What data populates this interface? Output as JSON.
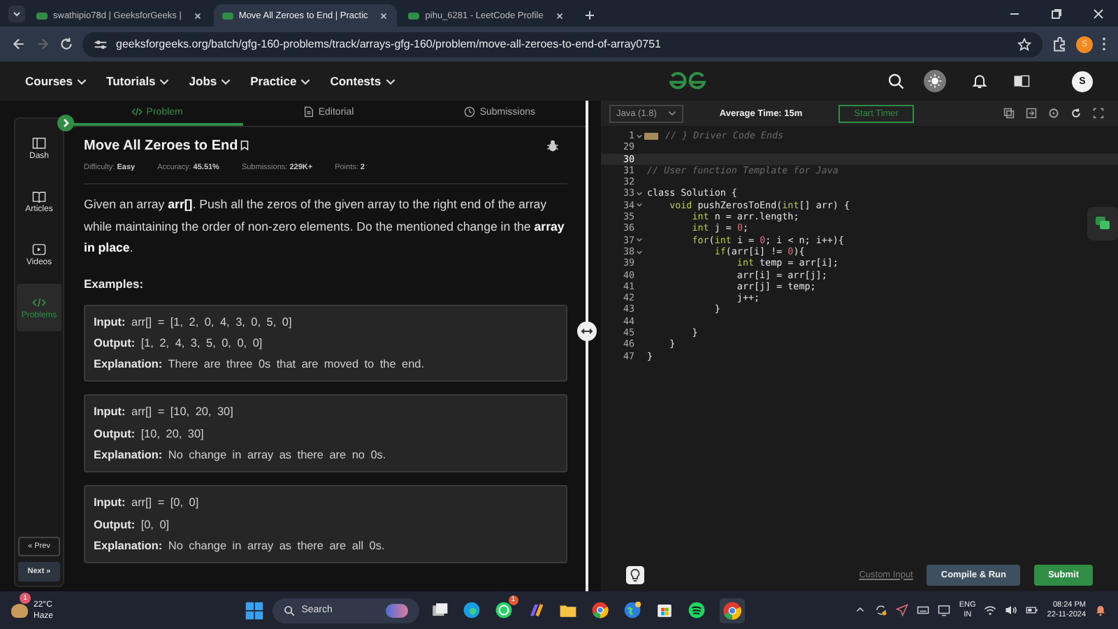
{
  "browser": {
    "tabs": [
      {
        "title": "swathipio78d | GeeksforGeeks |",
        "selected": false
      },
      {
        "title": "Move All Zeroes to End | Practic",
        "selected": true
      },
      {
        "title": "pihu_6281 - LeetCode Profile",
        "selected": false
      }
    ],
    "url": "geeksforgeeks.org/batch/gfg-160-problems/track/arrays-gfg-160/problem/move-all-zeroes-to-end-of-array0751",
    "profile_initial": "S"
  },
  "nav": {
    "items": [
      "Courses",
      "Tutorials",
      "Jobs",
      "Practice",
      "Contests"
    ],
    "avatar": "S"
  },
  "sidebar": {
    "items": [
      {
        "label": "Dash",
        "selected": false
      },
      {
        "label": "Articles",
        "selected": false
      },
      {
        "label": "Videos",
        "selected": false
      },
      {
        "label": "Problems",
        "selected": true
      }
    ],
    "prev": "« Prev",
    "next": "Next »"
  },
  "panel_tabs": [
    {
      "label": "Problem",
      "selected": true
    },
    {
      "label": "Editorial",
      "selected": false
    },
    {
      "label": "Submissions",
      "selected": false
    }
  ],
  "problem": {
    "title": "Move All Zeroes to End",
    "meta": [
      "Difficulty: **Easy**",
      "Accuracy: **45.51%**",
      "Submissions: **229K+**",
      "Points: **2**"
    ],
    "description": "Given an array **arr[]**. Push all the zeros of the given array to the right end of the array while maintaining the order of non-zero elements. Do the mentioned change in the **array in place**.",
    "examples_heading": "Examples:",
    "examples": [
      [
        "**Input:** arr[] = [1, 2, 0, 4, 3, 0, 5, 0]",
        "**Output:** [1, 2, 4, 3, 5, 0, 0, 0]",
        "**Explanation:** There are three 0s that are moved to the end."
      ],
      [
        "**Input:** arr[] = [10, 20, 30]",
        "**Output:** [10, 20, 30]",
        "**Explanation:** No change in array as there are no 0s."
      ],
      [
        "**Input:** arr[] = [0, 0]",
        "**Output:** [0, 0]",
        "**Explanation:** No change in array as there are all 0s."
      ]
    ]
  },
  "editor": {
    "language": "Java (1.8)",
    "average_time": "Average Time: 15m",
    "timer_button": "Start Timer",
    "lines": [
      {
        "n": "1",
        "fold": true,
        "folded": true,
        "active": false,
        "parts": [
          {
            "kind": "comment",
            "text": "// } Driver Code Ends"
          }
        ]
      },
      {
        "n": "29",
        "fold": false,
        "folded": false,
        "active": false
      },
      {
        "n": "30",
        "fold": false,
        "folded": false,
        "active": true
      },
      {
        "n": "31",
        "fold": false,
        "folded": false,
        "active": false,
        "parts": [
          {
            "kind": "comment",
            "text": "// User function Template for Java"
          }
        ]
      },
      {
        "n": "32",
        "fold": false,
        "folded": false,
        "active": false
      },
      {
        "n": "33",
        "fold": true,
        "folded": false,
        "active": false,
        "parts": [
          {
            "kind": "plain",
            "text": "class Solution {"
          }
        ]
      },
      {
        "n": "34",
        "fold": true,
        "folded": false,
        "active": false,
        "parts": [
          {
            "kind": "keyword",
            "text": "    void"
          },
          {
            "kind": "plain",
            "text": " pushZerosToEnd("
          },
          {
            "kind": "keyword",
            "text": "int"
          },
          {
            "kind": "plain",
            "text": "[] arr) {"
          }
        ]
      },
      {
        "n": "35",
        "fold": false,
        "folded": false,
        "active": false,
        "parts": [
          {
            "kind": "keyword",
            "text": "        int"
          },
          {
            "kind": "plain",
            "text": " n = arr.length;"
          }
        ]
      },
      {
        "n": "36",
        "fold": false,
        "folded": false,
        "active": false,
        "parts": [
          {
            "kind": "keyword",
            "text": "        int"
          },
          {
            "kind": "plain",
            "text": " j = "
          },
          {
            "kind": "number",
            "text": "0"
          },
          {
            "kind": "plain",
            "text": ";"
          }
        ]
      },
      {
        "n": "37",
        "fold": true,
        "folded": false,
        "active": false,
        "parts": [
          {
            "kind": "keyword",
            "text": "        for"
          },
          {
            "kind": "plain",
            "text": "("
          },
          {
            "kind": "keyword",
            "text": "int"
          },
          {
            "kind": "plain",
            "text": " i = "
          },
          {
            "kind": "number",
            "text": "0"
          },
          {
            "kind": "plain",
            "text": "; i < n; i++){"
          }
        ]
      },
      {
        "n": "38",
        "fold": true,
        "folded": false,
        "active": false,
        "parts": [
          {
            "kind": "keyword",
            "text": "            if"
          },
          {
            "kind": "plain",
            "text": "(arr[i] != "
          },
          {
            "kind": "number",
            "text": "0"
          },
          {
            "kind": "plain",
            "text": "){"
          }
        ]
      },
      {
        "n": "39",
        "fold": false,
        "folded": false,
        "active": false,
        "parts": [
          {
            "kind": "keyword",
            "text": "                int"
          },
          {
            "kind": "plain",
            "text": " temp = arr[i];"
          }
        ]
      },
      {
        "n": "40",
        "fold": false,
        "folded": false,
        "active": false,
        "parts": [
          {
            "kind": "plain",
            "text": "                arr[i] = arr[j];"
          }
        ]
      },
      {
        "n": "41",
        "fold": false,
        "folded": false,
        "active": false,
        "parts": [
          {
            "kind": "plain",
            "text": "                arr[j] = temp;"
          }
        ]
      },
      {
        "n": "42",
        "fold": false,
        "folded": false,
        "active": false,
        "parts": [
          {
            "kind": "plain",
            "text": "                j++;"
          }
        ]
      },
      {
        "n": "43",
        "fold": false,
        "folded": false,
        "active": false,
        "parts": [
          {
            "kind": "plain",
            "text": "            }"
          }
        ]
      },
      {
        "n": "44",
        "fold": false,
        "folded": false,
        "active": false
      },
      {
        "n": "45",
        "fold": false,
        "folded": false,
        "active": false,
        "parts": [
          {
            "kind": "plain",
            "text": "        }"
          }
        ]
      },
      {
        "n": "46",
        "fold": false,
        "folded": false,
        "active": false,
        "parts": [
          {
            "kind": "plain",
            "text": "    }"
          }
        ]
      },
      {
        "n": "47",
        "fold": false,
        "folded": false,
        "active": false,
        "parts": [
          {
            "kind": "plain",
            "text": "}"
          }
        ]
      }
    ],
    "custom_input": "Custom Input",
    "compile_button": "Compile & Run",
    "submit_button": "Submit"
  },
  "taskbar": {
    "weather": {
      "temp": "22°C",
      "condition": "Haze",
      "badge": "1"
    },
    "search": "Search",
    "whatsapp_badge": "1",
    "language": "ENG",
    "region": "IN",
    "time": "08:24 PM",
    "date": "22-11-2024"
  }
}
